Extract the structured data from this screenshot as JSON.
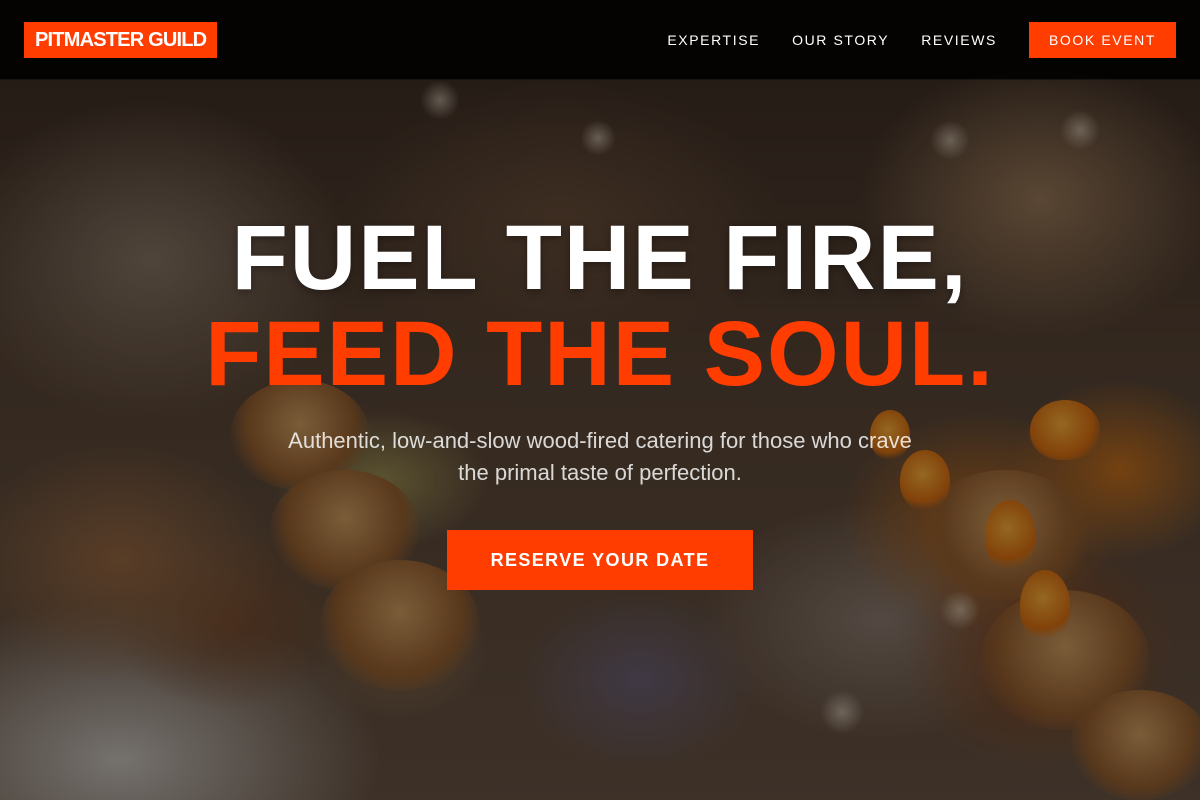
{
  "header": {
    "logo": "PITMASTER GUILD",
    "nav": [
      {
        "label": "EXPERTISE"
      },
      {
        "label": "OUR STORY"
      },
      {
        "label": "REVIEWS"
      }
    ],
    "cta_label": "BOOK EVENT"
  },
  "hero": {
    "line1": "FUEL THE FIRE,",
    "line2": "FEED THE SOUL.",
    "subtitle": "Authentic, low-and-slow wood-fired catering for those who crave the primal taste of perfection.",
    "cta_label": "RESERVE YOUR DATE",
    "background": "catering-food-photo"
  },
  "colors": {
    "accent": "#ff3d00",
    "header_bg": "#000000",
    "text": "#ffffff"
  }
}
